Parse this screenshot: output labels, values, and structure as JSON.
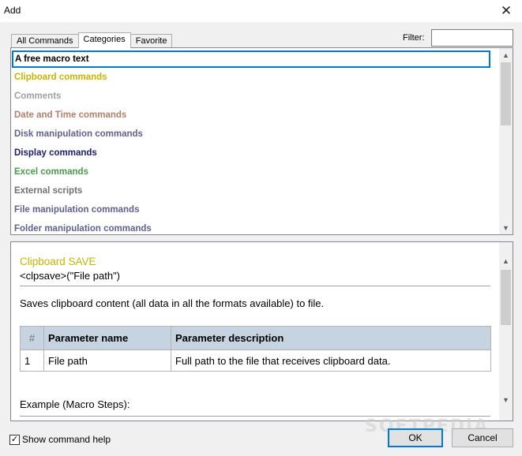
{
  "window": {
    "title": "Add"
  },
  "tabs": [
    {
      "label": "All Commands",
      "active": false
    },
    {
      "label": "Categories",
      "active": true
    },
    {
      "label": "Favorite",
      "active": false
    }
  ],
  "filter": {
    "label": "Filter:",
    "value": ""
  },
  "categories": [
    {
      "label": "A free macro text",
      "color": "#000000",
      "selected": true
    },
    {
      "label": "Clipboard commands",
      "color": "#c8b400"
    },
    {
      "label": "Comments",
      "color": "#a0a0a0"
    },
    {
      "label": "Date and Time commands",
      "color": "#b0806a"
    },
    {
      "label": "Disk manipulation commands",
      "color": "#606090"
    },
    {
      "label": "Display commands",
      "color": "#1a1a6e"
    },
    {
      "label": "Excel commands",
      "color": "#4a9a4a"
    },
    {
      "label": "External scripts",
      "color": "#707070"
    },
    {
      "label": "File manipulation commands",
      "color": "#606090"
    },
    {
      "label": "Folder manipulation commands",
      "color": "#606090"
    }
  ],
  "help": {
    "title": "Clipboard SAVE",
    "syntax": "<clpsave>(\"File path\")",
    "description": "Saves clipboard content (all data in all the formats available) to file.",
    "table": {
      "headers": [
        "#",
        "Parameter name",
        "Parameter description"
      ],
      "rows": [
        [
          "1",
          "File path",
          "Full path to the file that receives clipboard data."
        ]
      ]
    },
    "example_label": "Example (Macro Steps):"
  },
  "footer": {
    "show_help_label": "Show command help",
    "show_help_checked": true,
    "ok_label": "OK",
    "cancel_label": "Cancel"
  },
  "watermark": "SOFTPEDIA"
}
